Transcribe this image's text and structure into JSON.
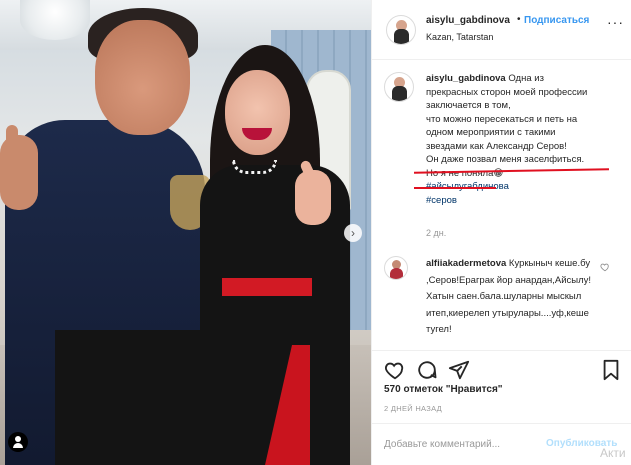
{
  "header": {
    "username": "aisylu_gabdinova",
    "separator": "•",
    "follow_label": "Подписаться",
    "location": "Kazan, Tatarstan",
    "more_icon": "more-horizontal-icon"
  },
  "caption": {
    "username": "aisylu_gabdinova",
    "lines": [
      "Одна из",
      "прекрасных сторон моей профессии",
      "заключается в том,",
      "что можно пересекаться и петь на",
      "одном мероприятии с такими",
      "звездами как Александр Серов!",
      "Он даже позвал меня заселфиться.",
      "Но я не поняла😁"
    ],
    "tags": [
      "#айсылугабдинова",
      "#серов"
    ],
    "time": "2 дн."
  },
  "comment": {
    "username": "alfiiakadermetova",
    "text": "Куркыныч кеше.бу ,Серов!Ераграк йор анардан,Айсылу! Хатын саен.бала.шуларны мыскыл итеп,киерелеп утырулары....уф,кеше тугел!"
  },
  "actions": {
    "like_icon": "heart-icon",
    "comment_icon": "comment-icon",
    "share_icon": "share-icon",
    "save_icon": "bookmark-icon"
  },
  "likes": "570 отметок \"Нравится\"",
  "post_date": "2 ДНЕЙ НАЗАД",
  "add_comment": {
    "placeholder": "Добавьте комментарий...",
    "publish_label": "Опубликовать"
  },
  "watermark": "Акти",
  "colors": {
    "link_blue": "#3897f0",
    "hashtag_blue": "#003569",
    "annotation_red": "#e01020",
    "publish_disabled": "#b2dffc"
  }
}
